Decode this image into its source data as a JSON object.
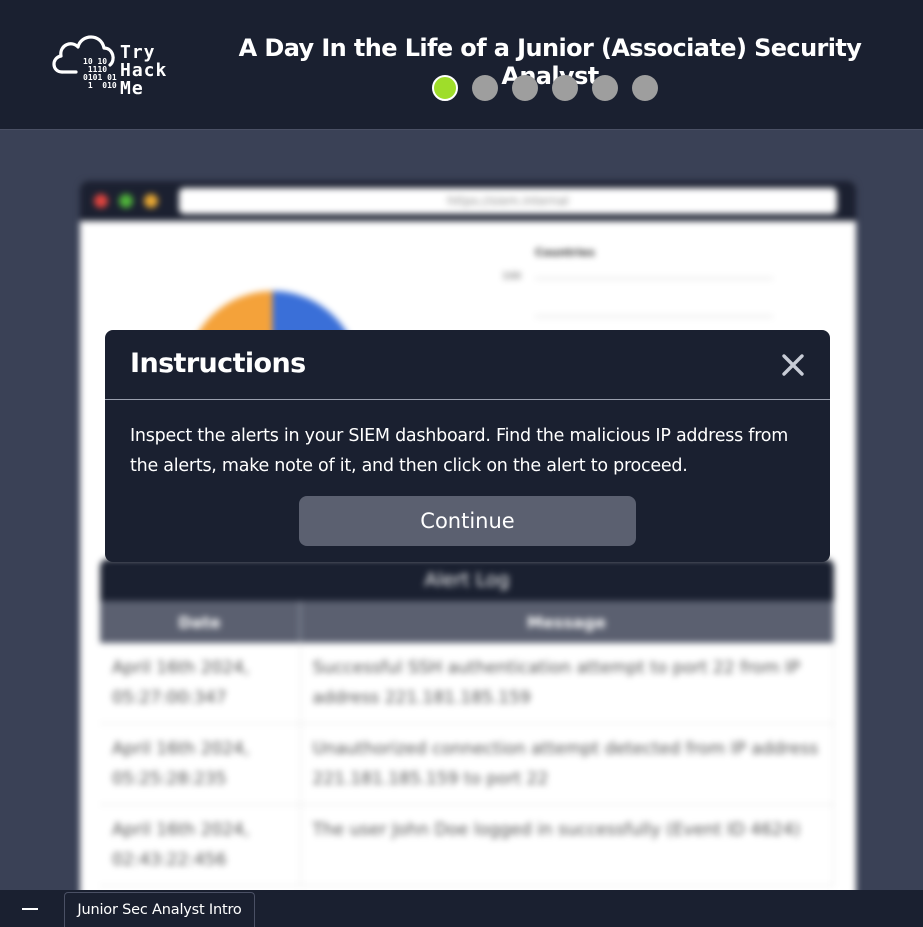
{
  "header": {
    "logo": {
      "line1": "Try",
      "line2": "Hack",
      "line3": "Me",
      "bits": "10 10\n 1110\n0101 01\n 1  010"
    },
    "title": "A Day In the Life of a Junior (Associate) Security Analyst",
    "steps": {
      "total": 6,
      "active_index": 0,
      "active_color": "#9fdd2a",
      "inactive_color": "#9e9e9e"
    }
  },
  "background": {
    "browser": {
      "url": "https://siem.internal"
    },
    "chart": {
      "label": "Countries",
      "tick": "100"
    },
    "alert_log": {
      "title": "Alert Log",
      "columns": [
        "Date",
        "Message"
      ],
      "rows": [
        {
          "date": "April 16th 2024, 05:27:00:347",
          "message": "Successful SSH authentication attempt to port 22 from IP address 221.181.185.159"
        },
        {
          "date": "April 16th 2024, 05:25:28:235",
          "message": "Unauthorized connection attempt detected from IP address 221.181.185.159 to port 22"
        },
        {
          "date": "April 16th 2024, 02:43:22:456",
          "message": "The user John Doe logged in successfully (Event ID 4624)"
        }
      ]
    }
  },
  "modal": {
    "title": "Instructions",
    "body": "Inspect the alerts in your SIEM dashboard. Find the malicious IP address from the alerts, make note of it, and then click on the alert to proceed.",
    "continue_label": "Continue",
    "close_icon": "close-icon"
  },
  "taskbar": {
    "minimize_icon": "minimize-icon",
    "tab_label": "Junior Sec Analyst Intro"
  },
  "colors": {
    "header_bg": "#1a2030",
    "page_bg": "#3a4156",
    "button_bg": "#5b6070",
    "accent_green": "#9fdd2a"
  }
}
